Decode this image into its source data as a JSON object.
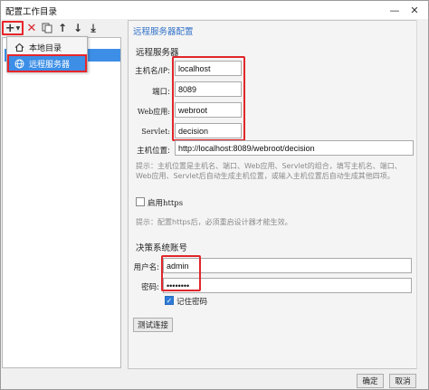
{
  "window": {
    "title": "配置工作目录",
    "minimize_icon": "minimize-icon",
    "close_icon": "close-icon"
  },
  "toolbar": {
    "add_icon": "plus-icon",
    "delete_icon": "delete-icon",
    "copy_icon": "copy-icon",
    "up_icon": "arrow-up-icon",
    "down_icon": "arrow-down-icon",
    "bottom_icon": "arrow-to-bottom-icon"
  },
  "add_menu": {
    "items": [
      {
        "label": "本地目录",
        "icon": "home-icon"
      },
      {
        "label": "远程服务器",
        "icon": "globe-icon"
      }
    ]
  },
  "panel": {
    "title": "远程服务器配置",
    "remote_section": "远程服务器",
    "host_label": "主机名/IP:",
    "host_value": "localhost",
    "port_label": "端口:",
    "port_value": "8089",
    "webapp_label": "Web应用:",
    "webapp_value": "webroot",
    "servlet_label": "Servlet:",
    "servlet_value": "decision",
    "location_label": "主机位置:",
    "location_value": "http://localhost:8089/webroot/decision",
    "hint1": "提示：主机位置是主机名、端口、Web应用、Servlet的组合，填写主机名、端口、Web应用、Servlet后自动生成主机位置，或输入主机位置后自动生成其他四项。",
    "https_label": "启用https",
    "https_checked": false,
    "hint2": "提示：配置https后，必须重启设计器才能生效。",
    "account_section": "决策系统账号",
    "user_label": "用户名:",
    "user_value": "admin",
    "password_label": "密码:",
    "password_value": "••••••••",
    "remember_label": "记住密码",
    "remember_checked": true,
    "test_button": "测试连接"
  },
  "footer": {
    "ok_button": "确定",
    "cancel_button": "取消"
  },
  "colors": {
    "accent": "#3c8ee6",
    "highlight_box": "#e0262b",
    "title_blue": "#2f6fc8"
  }
}
